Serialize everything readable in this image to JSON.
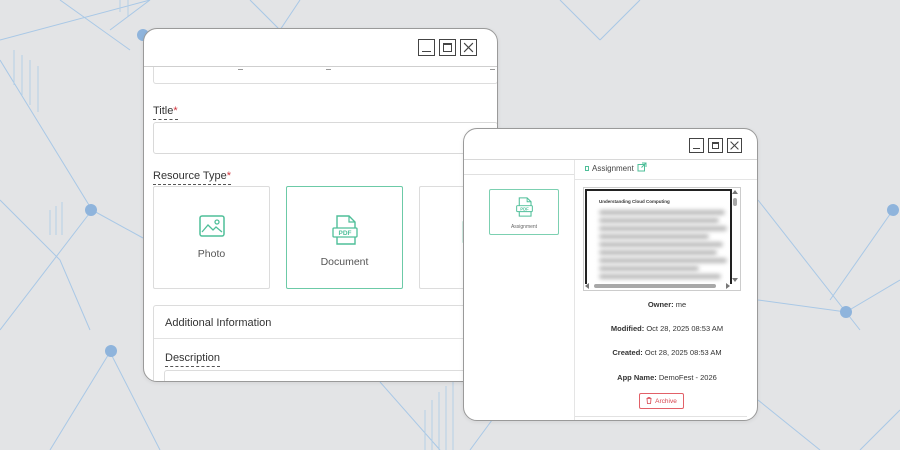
{
  "colors": {
    "background": "#e3e4e6",
    "decor_line": "#9cc0e0",
    "decor_dot": "#8fb4dc",
    "accent_green": "#4fbf99",
    "required": "#d0343d",
    "archive_red": "#d6424c"
  },
  "resource_form_window": {
    "controls": {
      "minimize_icon": "minimize-icon",
      "maximize_icon": "maximize-icon",
      "close_icon": "close-icon"
    },
    "title_label": "Title",
    "required_mark": "*",
    "resource_type_label": "Resource Type",
    "resource_types": [
      {
        "label": "Photo",
        "icon": "image-icon",
        "selected": false
      },
      {
        "label": "Document",
        "icon": "pdf-icon",
        "selected": true
      }
    ],
    "pdf_badge": "PDF",
    "additional_info_label": "Additional Information",
    "description_label": "Description"
  },
  "resource_detail_window": {
    "controls": {
      "minimize_icon": "minimize-icon",
      "maximize_icon": "maximize-icon",
      "close_icon": "close-icon"
    },
    "thumbnail_label": "Assignment",
    "assignment_link": "Assignment",
    "preview_title": "Understanding Cloud Computing",
    "owner_label": "Owner:",
    "owner_value": "me",
    "modified_label": "Modified:",
    "modified_value": "Oct 28, 2025 08:53 AM",
    "created_label": "Created:",
    "created_value": "Oct 28, 2025 08:53 AM",
    "app_name_label": "App Name:",
    "app_name_value": "DemoFest - 2026",
    "archive_button": "Archive",
    "archive_icon": "trash-icon"
  }
}
